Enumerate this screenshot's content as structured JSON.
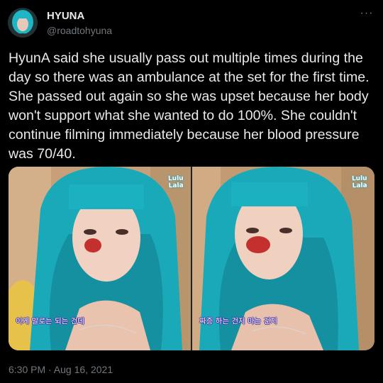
{
  "author": {
    "name": "HYUNA",
    "handle": "@roadtohyuna",
    "avatar_icon": "profile-avatar"
  },
  "more_icon": "more-horizontal-icon",
  "more_glyph": "···",
  "tweet": {
    "text": "HyunA said she usually pass out multiple times during the day so there was an ambulance at the set for the first time. She passed out again so she was upset because her body won't support what she wanted to do 100%. She couldn't continue filming immediately because her blood pressure was 70/40.",
    "timestamp": "6:30 PM · Aug 16, 2021"
  },
  "media": {
    "images": [
      {
        "watermark_line1": "Lulu",
        "watermark_line2": "Lala",
        "subtitle": "이게 말로는 되는 건데"
      },
      {
        "watermark_line1": "Lulu",
        "watermark_line2": "Lala",
        "subtitle": "짜증 하는 건지 마는 건지"
      }
    ]
  },
  "colors": {
    "background": "#000000",
    "text": "#e7e9ea",
    "secondary_text": "#71767b",
    "hair": "#1fb5c4"
  }
}
